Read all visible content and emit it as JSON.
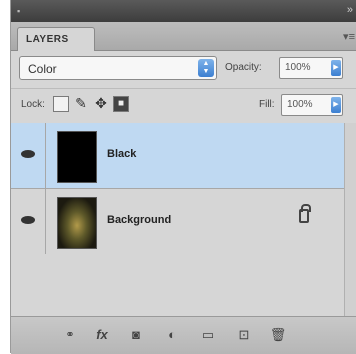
{
  "panel": {
    "tab_label": "LAYERS",
    "menu_icon": "panel-menu-icon"
  },
  "blend_mode": {
    "selected": "Color"
  },
  "opacity": {
    "label": "Opacity:",
    "value": "100%"
  },
  "lock": {
    "label": "Lock:",
    "icons": [
      "lock-transparent-icon",
      "lock-image-icon",
      "lock-position-icon",
      "lock-all-icon"
    ]
  },
  "fill": {
    "label": "Fill:",
    "value": "100%"
  },
  "layers": [
    {
      "name": "Black",
      "visible": true,
      "selected": true,
      "thumbnail": "black-fill",
      "locked": false
    },
    {
      "name": "Background",
      "visible": true,
      "selected": false,
      "thumbnail": "photo",
      "locked": true
    }
  ],
  "bottom_bar": {
    "icons": [
      "link-layers-icon",
      "layer-style-icon",
      "add-mask-icon",
      "adjustment-layer-icon",
      "new-group-icon",
      "new-layer-icon",
      "delete-layer-icon"
    ]
  },
  "colors": {
    "selected_row": "#bfd9f2",
    "accent": "#3c7fd1"
  }
}
